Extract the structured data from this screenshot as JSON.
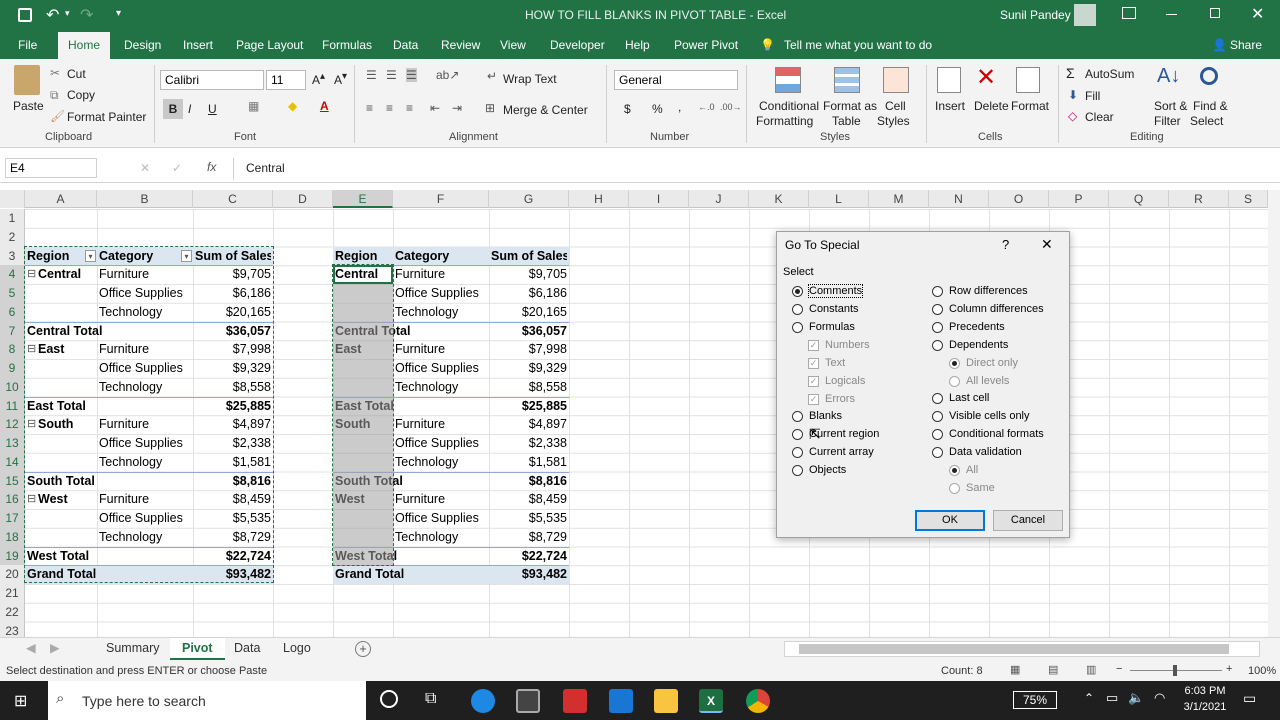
{
  "window": {
    "title": "HOW TO FILL BLANKS IN PIVOT TABLE  -  Excel",
    "user": "Sunil Pandey",
    "share": "Share",
    "tell_me": "Tell me what you want to do"
  },
  "ribbon_tabs": [
    "File",
    "Home",
    "Design",
    "Insert",
    "Page Layout",
    "Formulas",
    "Data",
    "Review",
    "View",
    "Developer",
    "Help",
    "Power Pivot"
  ],
  "ribbon": {
    "clipboard": {
      "paste": "Paste",
      "cut": "Cut",
      "copy": "Copy",
      "format_painter": "Format Painter",
      "label": "Clipboard"
    },
    "font": {
      "name": "Calibri",
      "size": "11",
      "bold": "B",
      "italic": "I",
      "underline": "U",
      "label": "Font"
    },
    "alignment": {
      "wrap": "Wrap Text",
      "merge": "Merge & Center",
      "label": "Alignment"
    },
    "number": {
      "format": "General",
      "currency": "$",
      "percent": "%",
      "comma": ",",
      "label": "Number"
    },
    "styles": {
      "conditional": "Conditional",
      "conditional2": "Formatting",
      "format_as": "Format as",
      "format_as2": "Table",
      "cell": "Cell",
      "cell2": "Styles",
      "label": "Styles"
    },
    "cells": {
      "insert": "Insert",
      "delete": "Delete",
      "format": "Format",
      "label": "Cells"
    },
    "editing": {
      "autosum": "AutoSum",
      "fill": "Fill",
      "clear": "Clear",
      "sort": "Sort &",
      "sort2": "Filter",
      "find": "Find &",
      "find2": "Select",
      "label": "Editing"
    }
  },
  "formula_bar": {
    "name_box": "E4",
    "fx": "fx",
    "content": "Central"
  },
  "columns": [
    "A",
    "B",
    "C",
    "D",
    "E",
    "F",
    "G",
    "H",
    "I",
    "J",
    "K",
    "L",
    "M",
    "N",
    "O",
    "P",
    "Q",
    "R",
    "S"
  ],
  "rows": [
    "1",
    "2",
    "3",
    "4",
    "5",
    "6",
    "7",
    "8",
    "9",
    "10",
    "11",
    "12",
    "13",
    "14",
    "15",
    "16",
    "17",
    "18",
    "19",
    "20",
    "21",
    "22",
    "23"
  ],
  "pivot1": {
    "headers": [
      "Region",
      "Category",
      "Sum of Sales"
    ],
    "rows": [
      {
        "region": "Central",
        "category": "Furniture",
        "sales": "$9,705",
        "type": "region"
      },
      {
        "region": "",
        "category": "Office Supplies",
        "sales": "$6,186",
        "type": "item"
      },
      {
        "region": "",
        "category": "Technology",
        "sales": "$20,165",
        "type": "item"
      },
      {
        "region": "Central Total",
        "category": "",
        "sales": "$36,057",
        "type": "total"
      },
      {
        "region": "East",
        "category": "Furniture",
        "sales": "$7,998",
        "type": "region"
      },
      {
        "region": "",
        "category": "Office Supplies",
        "sales": "$9,329",
        "type": "item"
      },
      {
        "region": "",
        "category": "Technology",
        "sales": "$8,558",
        "type": "item"
      },
      {
        "region": "East Total",
        "category": "",
        "sales": "$25,885",
        "type": "total"
      },
      {
        "region": "South",
        "category": "Furniture",
        "sales": "$4,897",
        "type": "region"
      },
      {
        "region": "",
        "category": "Office Supplies",
        "sales": "$2,338",
        "type": "item"
      },
      {
        "region": "",
        "category": "Technology",
        "sales": "$1,581",
        "type": "item"
      },
      {
        "region": "South Total",
        "category": "",
        "sales": "$8,816",
        "type": "total"
      },
      {
        "region": "West",
        "category": "Furniture",
        "sales": "$8,459",
        "type": "region"
      },
      {
        "region": "",
        "category": "Office Supplies",
        "sales": "$5,535",
        "type": "item"
      },
      {
        "region": "",
        "category": "Technology",
        "sales": "$8,729",
        "type": "item"
      },
      {
        "region": "West Total",
        "category": "",
        "sales": "$22,724",
        "type": "total"
      },
      {
        "region": "Grand Total",
        "category": "",
        "sales": "$93,482",
        "type": "grand"
      }
    ]
  },
  "dialog": {
    "title": "Go To Special",
    "help": "?",
    "close": "✕",
    "select_label": "Select",
    "left_options": [
      "Comments",
      "Constants",
      "Formulas",
      "Numbers",
      "Text",
      "Logicals",
      "Errors",
      "Blanks",
      "Current region",
      "Current array",
      "Objects"
    ],
    "right_options": [
      "Row differences",
      "Column differences",
      "Precedents",
      "Dependents",
      "Direct only",
      "All levels",
      "Last cell",
      "Visible cells only",
      "Conditional formats",
      "Data validation",
      "All",
      "Same"
    ],
    "selected": "Comments",
    "ok": "OK",
    "cancel": "Cancel"
  },
  "sheet_tabs": [
    "Summary",
    "Pivot",
    "Data",
    "Logo"
  ],
  "active_sheet": "Pivot",
  "status": {
    "message": "Select destination and press ENTER or choose Paste",
    "count": "Count: 8",
    "zoom": "100%"
  },
  "taskbar": {
    "search": "Type here to search",
    "battery": "75%",
    "time": "6:03 PM",
    "date": "3/1/2021"
  }
}
